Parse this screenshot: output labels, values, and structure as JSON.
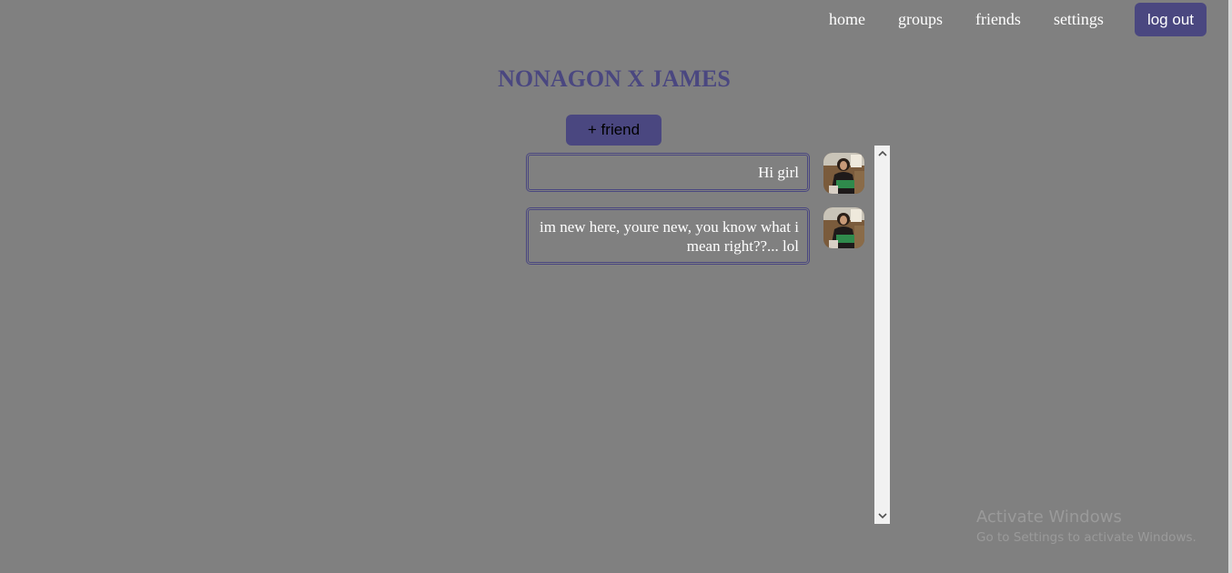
{
  "nav": {
    "links": [
      "home",
      "groups",
      "friends",
      "settings"
    ],
    "logout_label": "log out"
  },
  "page_title": "NONAGON X JAMES",
  "add_friend_label": "+ friend",
  "messages": [
    {
      "text": "Hi girl",
      "avatar": "user-photo"
    },
    {
      "text": "im new here, youre new, you know what i mean right??... lol",
      "avatar": "user-photo"
    }
  ],
  "watermark": {
    "title": "Activate Windows",
    "subtitle": "Go to Settings to activate Windows."
  },
  "colors": {
    "background": "#808080",
    "accent": "#4a4780",
    "text": "#ffffff"
  },
  "icons": {
    "scroll_up": "chevron-up-icon",
    "scroll_down": "chevron-down-icon"
  }
}
